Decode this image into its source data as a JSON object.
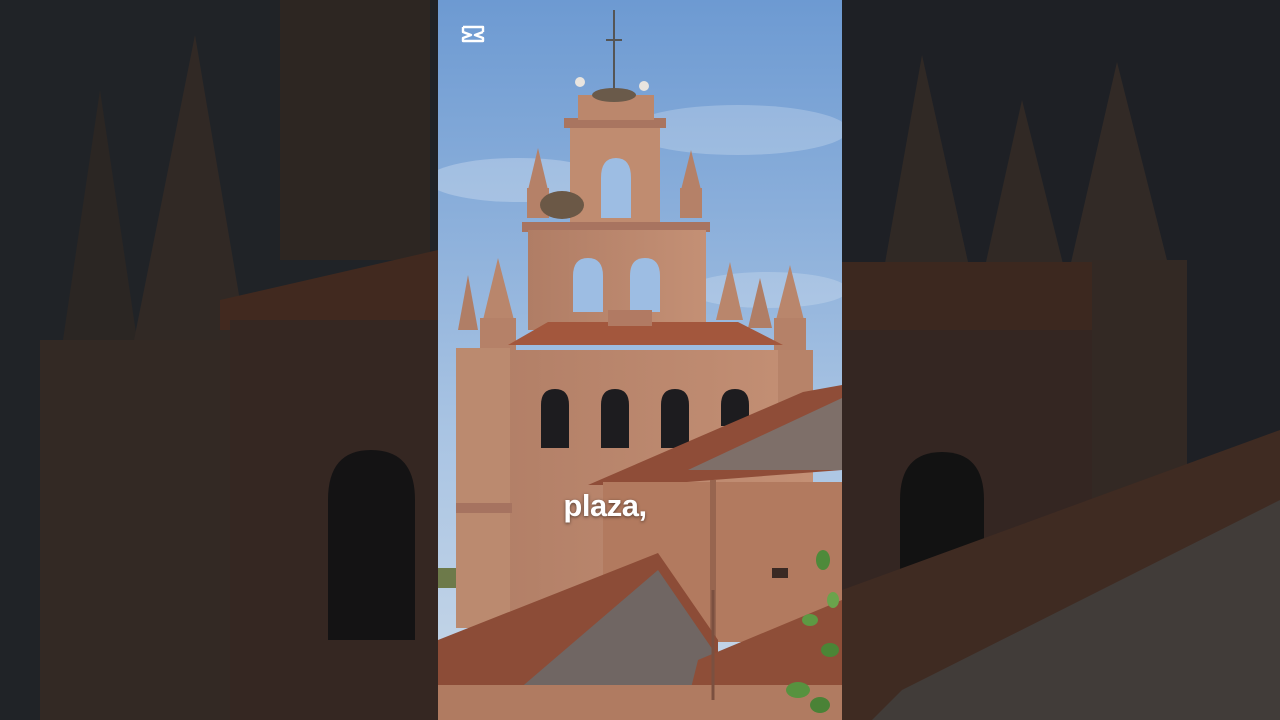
{
  "video": {
    "caption": "plaza,",
    "logo_icon": "capcut-logo-icon"
  },
  "colors": {
    "sky_top": "#6f9bd0",
    "sky_bottom": "#b7cee6",
    "stone": "#b9846a",
    "stone_dark": "#8d5f4a",
    "roof_tile": "#a4593f",
    "side_tint": "#2a2d33"
  }
}
